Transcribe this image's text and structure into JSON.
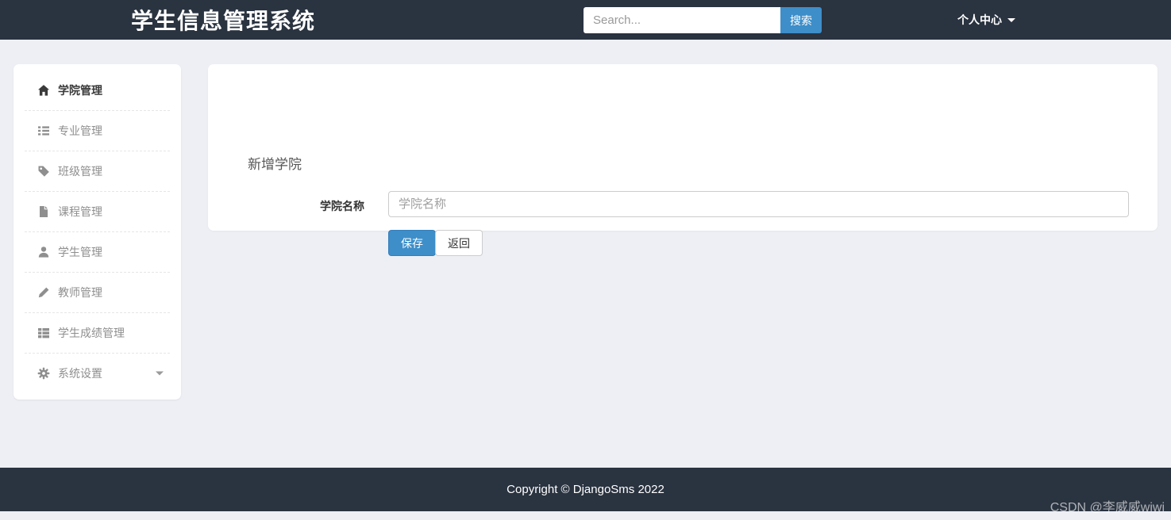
{
  "navbar": {
    "title": "学生信息管理系统",
    "search": {
      "placeholder": "Search...",
      "button_label": "搜索"
    },
    "user_menu": {
      "label": "个人中心"
    }
  },
  "sidebar": {
    "items": [
      {
        "label": "学院管理",
        "icon": "home-icon",
        "active": true
      },
      {
        "label": "专业管理",
        "icon": "list-icon",
        "active": false
      },
      {
        "label": "班级管理",
        "icon": "tag-icon",
        "active": false
      },
      {
        "label": "课程管理",
        "icon": "file-icon",
        "active": false
      },
      {
        "label": "学生管理",
        "icon": "user-icon",
        "active": false
      },
      {
        "label": "教师管理",
        "icon": "pencil-icon",
        "active": false
      },
      {
        "label": "学生成绩管理",
        "icon": "th-list-icon",
        "active": false
      },
      {
        "label": "系统设置",
        "icon": "gear-icon",
        "active": false,
        "has_submenu": true
      }
    ]
  },
  "main": {
    "panel_title": "新增学院",
    "form": {
      "field_label": "学院名称",
      "field_placeholder": "学院名称",
      "field_value": "",
      "save_label": "保存",
      "back_label": "返回"
    }
  },
  "footer": {
    "copyright": "Copyright © DjangoSms 2022"
  },
  "watermark": "CSDN @李威威wiwi",
  "colors": {
    "navbar_bg": "#2a3340",
    "accent_blue": "#3d8ec9",
    "body_bg": "#edeff4",
    "active_text": "#3a3a3a",
    "inactive_text": "#8f8f8f"
  }
}
